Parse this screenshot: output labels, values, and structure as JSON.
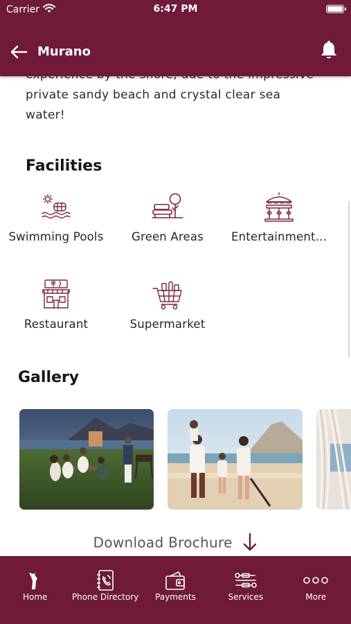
{
  "status_bar": {
    "carrier": "Carrier",
    "time": "6:47 PM"
  },
  "nav": {
    "title": "Murano"
  },
  "description": "experience by the shore, due to the impressive private sandy beach and crystal clear sea water!",
  "facilities": {
    "title": "Facilities",
    "items": [
      {
        "label": "Swimming Pools",
        "icon": "swimming-pool-icon"
      },
      {
        "label": "Green Areas",
        "icon": "green-areas-icon"
      },
      {
        "label": "Entertainment...",
        "icon": "entertainment-icon"
      },
      {
        "label": "Restaurant",
        "icon": "restaurant-icon"
      },
      {
        "label": "Supermarket",
        "icon": "supermarket-icon"
      }
    ]
  },
  "gallery": {
    "title": "Gallery"
  },
  "brochure": {
    "label": "Download Brochure"
  },
  "tabs": [
    {
      "label": "Home",
      "icon": "home-icon"
    },
    {
      "label": "Phone Directory",
      "icon": "phone-directory-icon"
    },
    {
      "label": "Payments",
      "icon": "wallet-icon"
    },
    {
      "label": "Services",
      "icon": "services-icon"
    },
    {
      "label": "More",
      "icon": "more-icon"
    }
  ],
  "colors": {
    "brand": "#6e1a38",
    "icon_stroke": "#7b2342"
  }
}
